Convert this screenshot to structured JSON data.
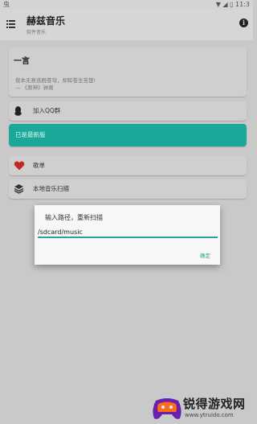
{
  "statusbar": {
    "left": "虫",
    "right": "▼ ◢ ▯ 11:3"
  },
  "appbar": {
    "title": "赫兹音乐",
    "subtitle": "软件音乐"
  },
  "quote": {
    "title": "一言",
    "line1": "我本无意逃脱苍穹，却知苍生苦楚!",
    "line2": "— 《原神》钟离"
  },
  "rows": {
    "join_qq": "加入QQ群",
    "latest": "已是最新版",
    "playlist": "歌单",
    "local_scan": "本地音乐扫描"
  },
  "dialog": {
    "title": "输入路径，重新扫描",
    "input_value": "/sdcard/music",
    "ok": "确定"
  },
  "watermark": {
    "name": "锐得游戏网",
    "url": "www.ytruido.com"
  },
  "colors": {
    "accent": "#1aa999",
    "heart": "#c62828"
  }
}
